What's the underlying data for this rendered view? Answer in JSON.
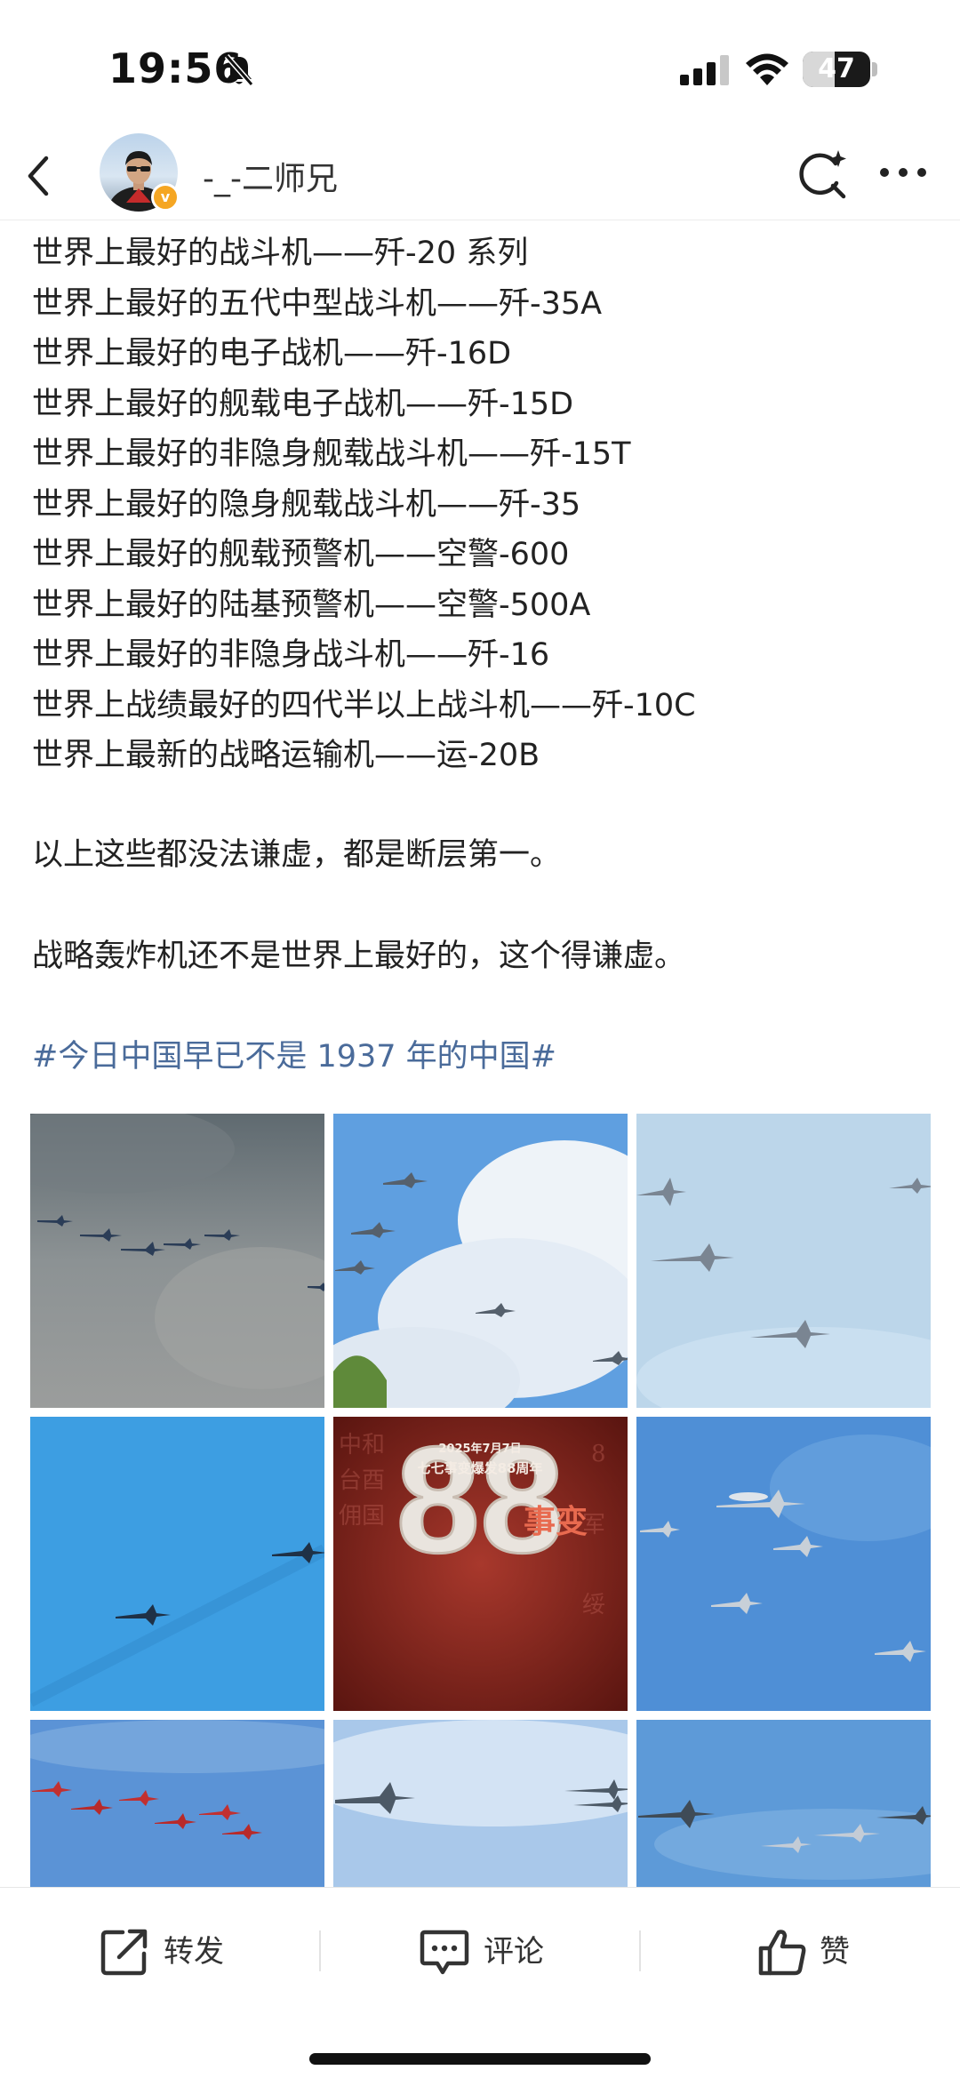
{
  "status_bar": {
    "time": "19:56",
    "battery_percent": 47,
    "battery_label": "47",
    "icons": [
      "bell-slash-icon",
      "cellular-signal-icon",
      "wifi-icon",
      "battery-icon"
    ]
  },
  "header": {
    "username": "-_-二师兄",
    "verified_badge": "v",
    "icons": [
      "back-icon",
      "search-sparkle-icon",
      "more-icon"
    ]
  },
  "post": {
    "lines": [
      "世界上最好的战斗机——歼-20 系列",
      "世界上最好的五代中型战斗机——歼-35A",
      "世界上最好的电子战机——歼-16D",
      "世界上最好的舰载电子战机——歼-15D",
      "世界上最好的非隐身舰载战斗机——歼-15T",
      "世界上最好的隐身舰载战斗机——歼-35",
      "世界上最好的舰载预警机——空警-600",
      "世界上最好的陆基预警机——空警-500A",
      "世界上最好的非隐身战斗机——歼-16",
      "世界上战绩最好的四代半以上战斗机——歼-10C",
      "世界上最新的战略运输机——运-20B"
    ],
    "paragraph_1": "以上这些都没法谦虚，都是断层第一。",
    "paragraph_2": "战略轰炸机还不是世界上最好的，这个得谦虚。",
    "hashtag": "#今日中国早已不是 1937 年的中国#"
  },
  "poster": {
    "date": "2025年7月7日",
    "title": "七七事变爆发88周年",
    "big_text": "事变",
    "number": "88"
  },
  "actions": {
    "repost_label": "转发",
    "comment_label": "评论",
    "like_label": "赞"
  },
  "colors": {
    "hashtag": "#4a6b9a",
    "badge": "#f5a623",
    "poster_red": "#8a2a22"
  }
}
